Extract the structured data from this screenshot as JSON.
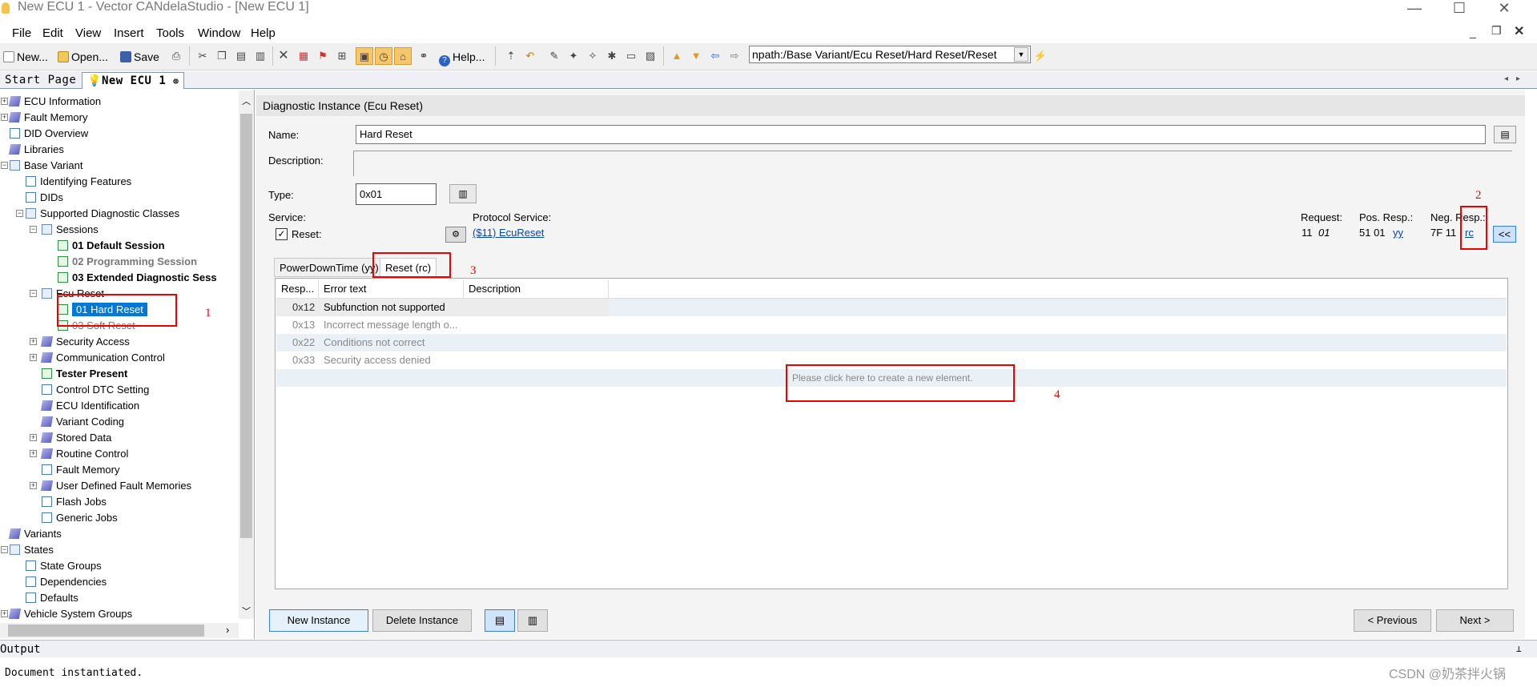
{
  "window": {
    "title": "New ECU 1 - Vector CANdelaStudio - [New ECU 1]"
  },
  "menu": [
    "File",
    "Edit",
    "View",
    "Insert",
    "Tools",
    "Window",
    "Help"
  ],
  "toolbar": {
    "new": "New...",
    "open": "Open...",
    "save": "Save",
    "help": "Help...",
    "npath": "npath:/Base Variant/Ecu Reset/Hard Reset/Reset"
  },
  "doctabs": {
    "start": "Start Page",
    "active": "New ECU 1"
  },
  "tree": [
    {
      "label": "ECU Information",
      "lvl": 0,
      "icon": "cube",
      "exp": "+"
    },
    {
      "label": "Fault Memory",
      "lvl": 0,
      "icon": "cube",
      "exp": "+"
    },
    {
      "label": "DID Overview",
      "lvl": 0,
      "icon": "doc"
    },
    {
      "label": "Libraries",
      "lvl": 0,
      "icon": "cube"
    },
    {
      "label": "Base Variant",
      "lvl": 0,
      "icon": "book",
      "exp": "-"
    },
    {
      "label": "Identifying Features",
      "lvl": 1,
      "icon": "doc"
    },
    {
      "label": "DIDs",
      "lvl": 1,
      "icon": "doc"
    },
    {
      "label": "Supported Diagnostic Classes",
      "lvl": 1,
      "icon": "book",
      "exp": "-"
    },
    {
      "label": "Sessions",
      "lvl": 2,
      "icon": "book",
      "exp": "-"
    },
    {
      "label": "01 Default Session",
      "lvl": 3,
      "icon": "gdoc",
      "bold": true
    },
    {
      "label": "02 Programming Session",
      "lvl": 3,
      "icon": "gdoc",
      "bold": true,
      "gray": true
    },
    {
      "label": "03 Extended Diagnostic Sess",
      "lvl": 3,
      "icon": "gdoc",
      "bold": true
    },
    {
      "label": "Ecu Reset",
      "lvl": 2,
      "icon": "book",
      "exp": "-"
    },
    {
      "label": "01 Hard Reset",
      "lvl": 3,
      "icon": "gdoc",
      "selected": true
    },
    {
      "label": "03 Soft Reset",
      "lvl": 3,
      "icon": "gdoc",
      "gray": true
    },
    {
      "label": "Security Access",
      "lvl": 2,
      "icon": "cube",
      "exp": "+"
    },
    {
      "label": "Communication Control",
      "lvl": 2,
      "icon": "cube",
      "exp": "+"
    },
    {
      "label": "Tester Present",
      "lvl": 2,
      "icon": "gdoc",
      "bold": true
    },
    {
      "label": "Control DTC Setting",
      "lvl": 2,
      "icon": "doc"
    },
    {
      "label": "ECU Identification",
      "lvl": 2,
      "icon": "cube"
    },
    {
      "label": "Variant Coding",
      "lvl": 2,
      "icon": "cube"
    },
    {
      "label": "Stored Data",
      "lvl": 2,
      "icon": "cube",
      "exp": "+"
    },
    {
      "label": "Routine Control",
      "lvl": 2,
      "icon": "cube",
      "exp": "+"
    },
    {
      "label": "Fault Memory",
      "lvl": 2,
      "icon": "doc"
    },
    {
      "label": "User Defined Fault Memories",
      "lvl": 2,
      "icon": "cube",
      "exp": "+"
    },
    {
      "label": "Flash Jobs",
      "lvl": 2,
      "icon": "doc"
    },
    {
      "label": "Generic Jobs",
      "lvl": 2,
      "icon": "doc"
    },
    {
      "label": "Variants",
      "lvl": 0,
      "icon": "cube"
    },
    {
      "label": "States",
      "lvl": 0,
      "icon": "book",
      "exp": "-"
    },
    {
      "label": "State Groups",
      "lvl": 1,
      "icon": "doc"
    },
    {
      "label": "Dependencies",
      "lvl": 1,
      "icon": "doc"
    },
    {
      "label": "Defaults",
      "lvl": 1,
      "icon": "doc"
    },
    {
      "label": "Vehicle System Groups",
      "lvl": 0,
      "icon": "cube",
      "exp": "+"
    }
  ],
  "panel": {
    "header": "Diagnostic Instance (Ecu Reset)",
    "name_label": "Name:",
    "name_value": "Hard Reset",
    "desc_label": "Description:",
    "type_label": "Type:",
    "type_value": "0x01",
    "service_label": "Service:",
    "reset_label": "Reset:",
    "protocol_label": "Protocol Service:",
    "protocol_link": "($11) EcuReset",
    "request_label": "Request:",
    "request_value": "11",
    "request_param": "01",
    "pos_label": "Pos. Resp.:",
    "pos_value": "51 01",
    "pos_link": "yy",
    "neg_label": "Neg. Resp.:",
    "neg_value": "7F 11",
    "neg_link": "rc",
    "collapse_btn": "<<",
    "tabs": [
      "PowerDownTime (yy)",
      "Reset (rc)"
    ],
    "columns": [
      "Resp...",
      "Error text",
      "Description"
    ],
    "rows": [
      {
        "code": "0x12",
        "text": "Subfunction not supported"
      },
      {
        "code": "0x13",
        "text": "Incorrect message length o..."
      },
      {
        "code": "0x22",
        "text": "Conditions not correct"
      },
      {
        "code": "0x33",
        "text": "Security access denied"
      }
    ],
    "create_hint": "Please click here to create a new element.",
    "new_instance": "New Instance",
    "delete_instance": "Delete Instance",
    "previous": "< Previous",
    "next": "Next >"
  },
  "annotations": [
    "1",
    "2",
    "3",
    "4"
  ],
  "output": {
    "title": "Output",
    "line": "Document instantiated."
  },
  "watermark": "CSDN @奶茶拌火锅"
}
